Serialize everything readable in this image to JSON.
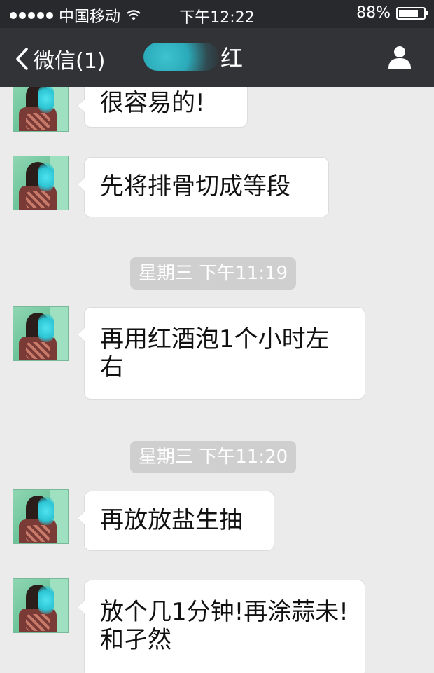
{
  "status_bar": {
    "carrier": "中国移动",
    "time": "下午12:22",
    "battery": "88%",
    "battery_level": 0.88
  },
  "nav": {
    "back_label": "微信(1)",
    "title": "红"
  },
  "messages": [
    {
      "text": "很容易的!"
    },
    {
      "text": "先将排骨切成等段"
    },
    {
      "timestamp": "星期三 下午11:19"
    },
    {
      "text": "再用红酒泡1个小时左右"
    },
    {
      "timestamp": "星期三 下午11:20"
    },
    {
      "text": "再放放盐生抽"
    },
    {
      "text": "放个几1分钟!再涂蒜未!和孑然"
    }
  ],
  "colors": {
    "status_bar": "#27292c",
    "nav_bar": "#313337",
    "chat_background": "#ebebeb",
    "bubble": "#ffffff",
    "timestamp_pill": "#cfcfcf"
  }
}
